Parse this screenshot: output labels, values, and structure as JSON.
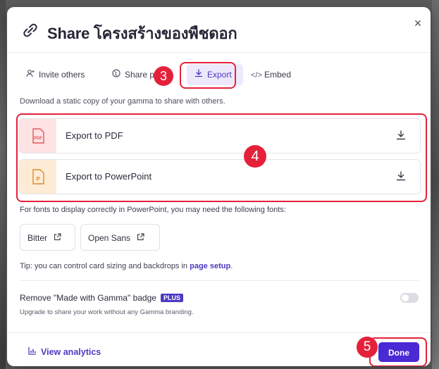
{
  "header": {
    "title": "Share โครงสร้างของพืชดอก",
    "title_icon": "link-icon",
    "close_label": "×"
  },
  "tabs": [
    {
      "label": "Invite others",
      "icon": "add-user-icon"
    },
    {
      "label": "Share pu",
      "icon": "globe-icon"
    },
    {
      "label": "Export",
      "icon": "download-icon",
      "active": true
    },
    {
      "label": "Embed",
      "icon": "code-icon"
    }
  ],
  "export": {
    "description": "Download a static copy of your gamma to share with others.",
    "options": [
      {
        "label": "Export to PDF",
        "icon": "pdf-file-icon",
        "color": "#fde3e3"
      },
      {
        "label": "Export to PowerPoint",
        "icon": "powerpoint-file-icon",
        "color": "#fdecd5"
      }
    ]
  },
  "fonts": {
    "note": "For fonts to display correctly in PowerPoint, you may need the following fonts:",
    "items": [
      "Bitter",
      "Open Sans"
    ]
  },
  "tip": {
    "text": "Tip: you can control card sizing and backdrops in ",
    "link": "page setup",
    "suffix": "."
  },
  "badge_setting": {
    "title": "Remove \"Made with Gamma\" badge",
    "plan": "PLUS",
    "subtitle": "Upgrade to share your work without any Gamma branding.",
    "enabled": false
  },
  "footer": {
    "analytics_label": "View analytics",
    "done_label": "Done"
  },
  "annotations": {
    "step3": "3",
    "step4": "4",
    "step5": "5"
  },
  "colors": {
    "accent": "#4b3ac4",
    "done_button": "#4a2ad4",
    "callout": "#e5213a"
  }
}
